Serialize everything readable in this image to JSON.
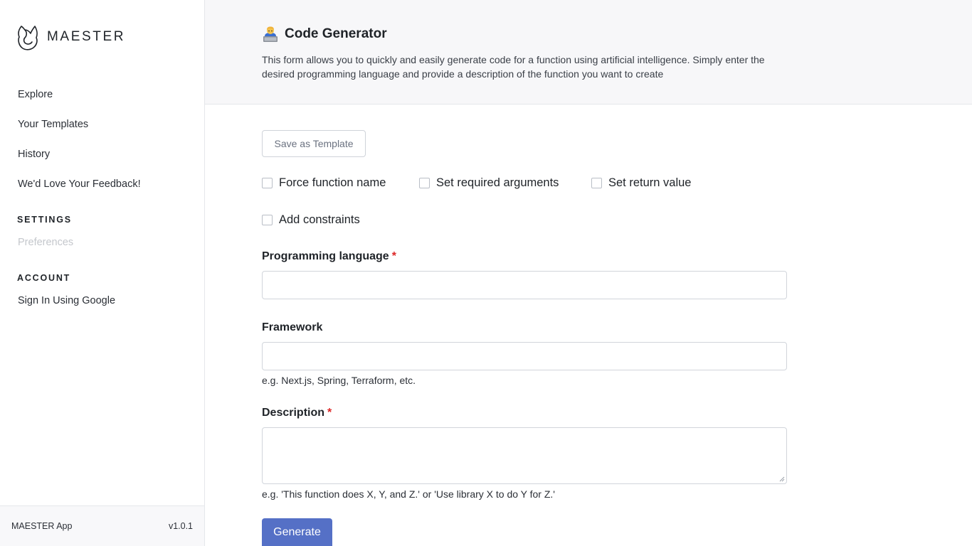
{
  "sidebar": {
    "brand": "MAESTER",
    "nav": [
      {
        "label": "Explore"
      },
      {
        "label": "Your Templates"
      },
      {
        "label": "History"
      },
      {
        "label": "We'd Love Your Feedback!"
      }
    ],
    "settings_heading": "SETTINGS",
    "preferences_label": "Preferences",
    "account_heading": "ACCOUNT",
    "sign_in_label": "Sign In Using Google",
    "footer_app": "MAESTER App",
    "footer_version": "v1.0.1"
  },
  "header": {
    "title": "Code Generator",
    "icon": "technologist-emoji-icon",
    "description": "This form allows you to quickly and easily generate code for a function using artificial intelligence. Simply enter the desired programming language and provide a description of the function you want to create"
  },
  "form": {
    "save_template_label": "Save as Template",
    "checkboxes": [
      {
        "label": "Force function name",
        "checked": false
      },
      {
        "label": "Set required arguments",
        "checked": false
      },
      {
        "label": "Set return value",
        "checked": false
      },
      {
        "label": "Add constraints",
        "checked": false
      }
    ],
    "language": {
      "label": "Programming language",
      "required_mark": "*",
      "value": ""
    },
    "framework": {
      "label": "Framework",
      "value": "",
      "hint": "e.g. Next.js, Spring, Terraform, etc."
    },
    "description": {
      "label": "Description",
      "required_mark": "*",
      "value": "",
      "hint": "e.g. 'This function does X, Y, and Z.' or 'Use library X to do Y for Z.'"
    },
    "generate_label": "Generate"
  },
  "colors": {
    "primary": "#5570c6",
    "required": "#dc2626",
    "disabled_text": "#c4c7cc"
  }
}
